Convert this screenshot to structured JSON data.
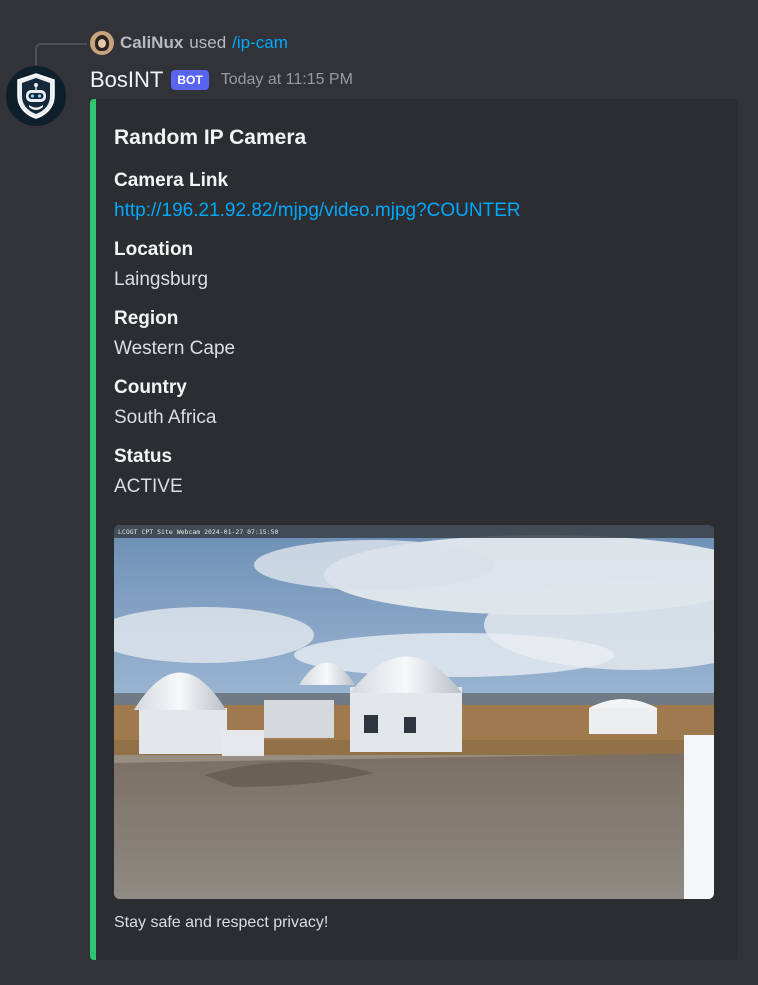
{
  "reply": {
    "user": "CaliNux",
    "verb": "used",
    "command": "/ip-cam"
  },
  "message": {
    "username": "BosINT",
    "tag": "BOT",
    "timestamp": "Today at 11:15 PM"
  },
  "embed": {
    "accent_color": "#2dc770",
    "title": "Random IP Camera",
    "fields": [
      {
        "name": "Camera Link",
        "value": "http://196.21.92.82/mjpg/video.mjpg?COUNTER"
      },
      {
        "name": "Location",
        "value": "Laingsburg"
      },
      {
        "name": "Region",
        "value": "Western Cape"
      },
      {
        "name": "Country",
        "value": "South Africa"
      },
      {
        "name": "Status",
        "value": "ACTIVE"
      }
    ],
    "image_overlay": "LCOGT CPT Site Webcam  2024-01-27 07:15:50",
    "footer": "Stay safe and respect privacy!"
  },
  "icons": {
    "bot_avatar": "robot-shield-icon",
    "reply_avatar": "user-avatar"
  }
}
